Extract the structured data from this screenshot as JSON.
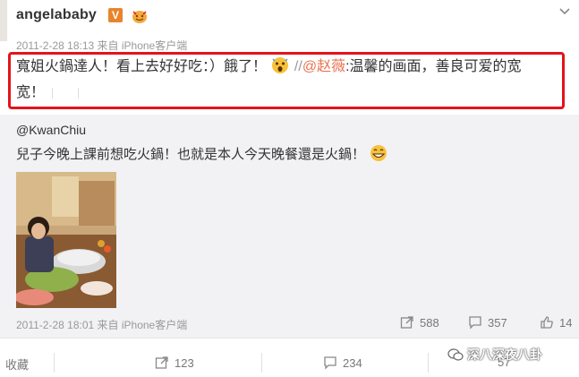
{
  "post": {
    "username": "angelababy",
    "verified_label": "V",
    "timestamp": "2011-2-28 18:13 来自 iPhone客户端",
    "text_part1": "寬姐火鍋達人！看上去好好吃：）餓了！",
    "text_sep": "//",
    "mention": "@赵薇",
    "text_part2": ":温馨的画面，善良可爱的宽",
    "text_line2": "宽！"
  },
  "repost": {
    "user": "@KwanChiu",
    "text": "兒子今晚上課前想吃火鍋！也就是本人今天晚餐還是火鍋！",
    "timestamp": "2011-2-28 18:01 来自 iPhone客户端",
    "reposts": "588",
    "comments": "357",
    "likes": "14"
  },
  "actions": {
    "favorite": "收藏",
    "repost": "123",
    "comment": "234",
    "like": "57"
  },
  "watermark": {
    "text": "深八深夜八卦"
  },
  "colors": {
    "accent_orange": "#e8852c",
    "mention": "#eb7350",
    "highlight_border": "#e4131c",
    "repost_bg": "#f2f2f5"
  }
}
